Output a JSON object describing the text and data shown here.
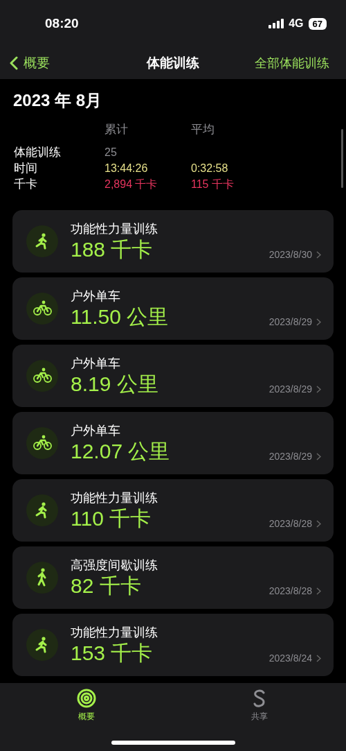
{
  "status_bar": {
    "time": "08:20",
    "network": "4G",
    "battery": "67"
  },
  "nav": {
    "back": "概要",
    "title": "体能训练",
    "action": "全部体能训练"
  },
  "month": "2023 年 8月",
  "summary": {
    "columns": [
      "累计",
      "平均"
    ],
    "rows": [
      {
        "label": "体能训练",
        "kind": "count",
        "total": "25"
      },
      {
        "label": "时间",
        "kind": "time",
        "total": "13:44:26",
        "average": "0:32:58"
      },
      {
        "label": "千卡",
        "kind": "energy",
        "total": "2,894 千卡",
        "average": "115 千卡"
      }
    ]
  },
  "workouts": [
    {
      "kind": "strength",
      "name": "功能性力量训练",
      "value": "188 千卡",
      "date": "2023/8/30"
    },
    {
      "kind": "cycling",
      "name": "户外单车",
      "value": "11.50 公里",
      "date": "2023/8/29"
    },
    {
      "kind": "cycling",
      "name": "户外单车",
      "value": "8.19 公里",
      "date": "2023/8/29"
    },
    {
      "kind": "cycling",
      "name": "户外单车",
      "value": "12.07 公里",
      "date": "2023/8/29"
    },
    {
      "kind": "strength",
      "name": "功能性力量训练",
      "value": "110 千卡",
      "date": "2023/8/28"
    },
    {
      "kind": "hiit",
      "name": "高强度间歇训练",
      "value": "82 千卡",
      "date": "2023/8/28"
    },
    {
      "kind": "strength",
      "name": "功能性力量训练",
      "value": "153 千卡",
      "date": "2023/8/24"
    }
  ],
  "tab_bar": [
    {
      "label": "概要",
      "kind": "summary",
      "selected": true
    },
    {
      "label": "共享",
      "kind": "sharing",
      "selected": false
    }
  ]
}
